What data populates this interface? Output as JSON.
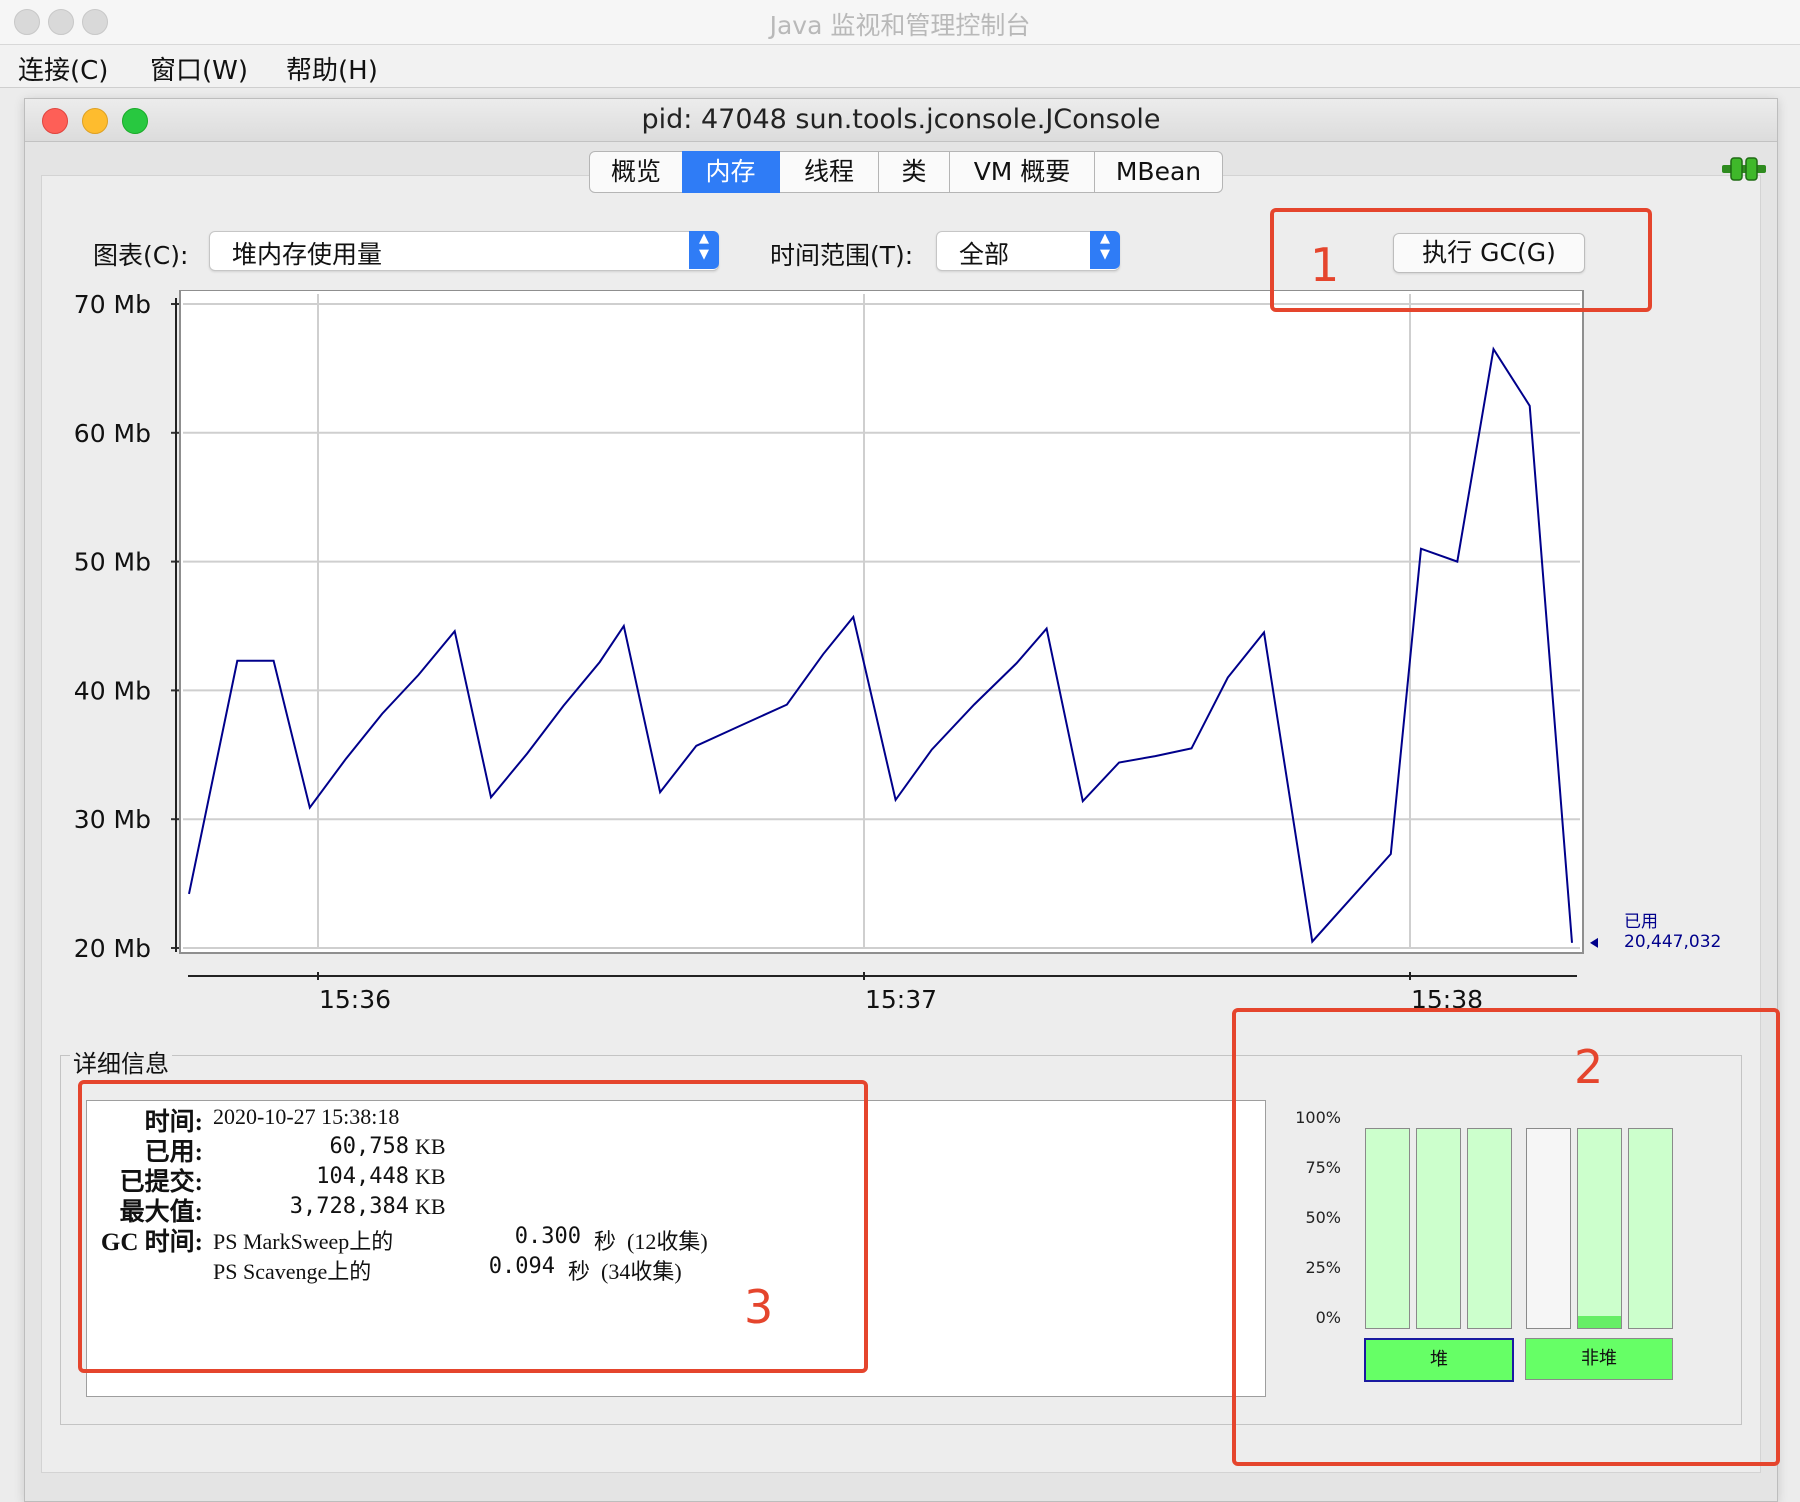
{
  "outer_window": {
    "title": "Java 监视和管理控制台",
    "menu": [
      "连接(C)",
      "窗口(W)",
      "帮助(H)"
    ]
  },
  "inner_window": {
    "title": "pid: 47048 sun.tools.jconsole.JConsole",
    "tabs": [
      "概览",
      "内存",
      "线程",
      "类",
      "VM 概要",
      "MBean"
    ],
    "active_tab": "内存"
  },
  "controls": {
    "chart_label": "图表(C):",
    "chart_value": "堆内存使用量",
    "time_range_label": "时间范围(T):",
    "time_range_value": "全部",
    "gc_button": "执行 GC(G)"
  },
  "chart_data": {
    "type": "line",
    "ylim": [
      20,
      70
    ],
    "y_ticks": [
      "20 Mb",
      "30 Mb",
      "40 Mb",
      "50 Mb",
      "60 Mb",
      "70 Mb"
    ],
    "x_ticks": [
      "15:36",
      "15:37",
      "15:38"
    ],
    "series": [
      {
        "name": "已用",
        "color": "#00008b",
        "points": [
          [
            0.0,
            24.2
          ],
          [
            0.4,
            42.3
          ],
          [
            0.7,
            42.3
          ],
          [
            1.0,
            30.9
          ],
          [
            1.3,
            34.7
          ],
          [
            1.6,
            38.2
          ],
          [
            1.9,
            41.2
          ],
          [
            2.2,
            44.6
          ],
          [
            2.5,
            31.7
          ],
          [
            2.8,
            35.1
          ],
          [
            3.1,
            38.8
          ],
          [
            3.4,
            42.2
          ],
          [
            3.6,
            45.0
          ],
          [
            3.9,
            32.1
          ],
          [
            4.2,
            35.7
          ],
          [
            4.55,
            37.2
          ],
          [
            4.95,
            38.9
          ],
          [
            5.25,
            42.8
          ],
          [
            5.5,
            45.7
          ],
          [
            5.85,
            31.5
          ],
          [
            6.15,
            35.4
          ],
          [
            6.5,
            38.9
          ],
          [
            6.85,
            42.1
          ],
          [
            7.1,
            44.8
          ],
          [
            7.4,
            31.4
          ],
          [
            7.7,
            34.4
          ],
          [
            8.0,
            34.9
          ],
          [
            8.3,
            35.5
          ],
          [
            8.6,
            41.0
          ],
          [
            8.9,
            44.5
          ],
          [
            9.3,
            20.5
          ],
          [
            9.95,
            27.3
          ],
          [
            10.2,
            51.0
          ],
          [
            10.5,
            50.0
          ],
          [
            10.8,
            66.5
          ],
          [
            11.1,
            62.1
          ],
          [
            11.45,
            20.4
          ]
        ]
      }
    ],
    "current_value_label": "已用",
    "current_value": "20,447,032"
  },
  "details": {
    "legend": "详细信息",
    "time_key": "时间:",
    "time_value": "2020-10-27 15:38:18",
    "used_key": "已用:",
    "used_value": "60,758",
    "committed_key": "已提交:",
    "committed_value": "104,448",
    "max_key": "最大值:",
    "max_value": "3,728,384",
    "unit": "KB",
    "gc_key": "GC 时间:",
    "gc_rows": [
      {
        "collector": "PS MarkSweep上的",
        "seconds": "0.300",
        "unit": "秒",
        "count": "(12收集)"
      },
      {
        "collector": "PS Scavenge上的",
        "seconds": "0.094",
        "unit": "秒",
        "count": "(34收集)"
      }
    ]
  },
  "memory_pools": {
    "scale": [
      "100%",
      "75%",
      "50%",
      "25%",
      "0%"
    ],
    "heap_label": "堆",
    "nonheap_label": "非堆",
    "heap_bars": [
      0.0,
      0.0,
      0.0
    ],
    "nonheap_bars": [
      0.0,
      0.06,
      0.0
    ]
  },
  "annotations": [
    "1",
    "2",
    "3"
  ],
  "colors": {
    "accent": "#2f7cf6",
    "annotation": "#e5452d",
    "series": "#00008b",
    "bar_bg": "#ccffcc",
    "bar_fill": "#66ee66",
    "pool_button": "#66ff66"
  }
}
